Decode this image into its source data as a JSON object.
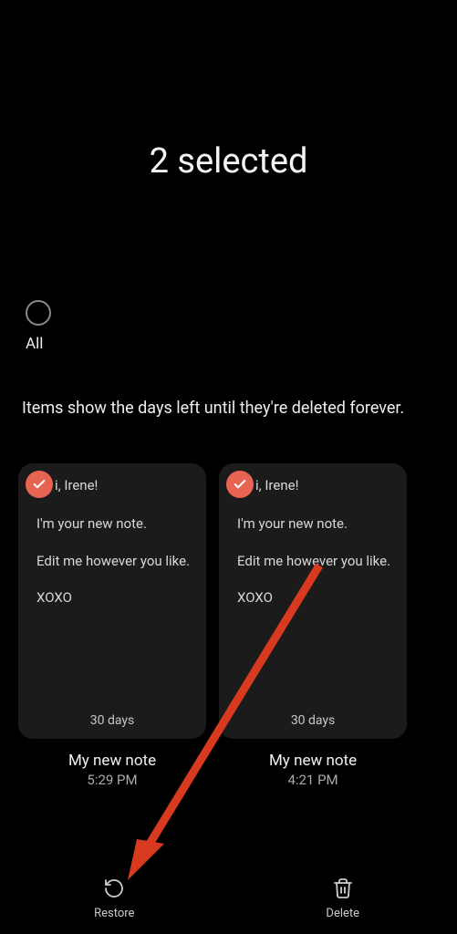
{
  "header": {
    "title": "2 selected"
  },
  "all": {
    "label": "All"
  },
  "info": "Items show the days left until they're deleted forever.",
  "notes": [
    {
      "greeting": "i, Irene!",
      "body": "I'm your new note.\n\nEdit me however you like.\n\nXOXO",
      "days": "30 days",
      "title": "My new note",
      "time": "5:29 PM"
    },
    {
      "greeting": "i, Irene!",
      "body": "I'm your new note.\n\nEdit me however you like.\n\nXOXO",
      "days": "30 days",
      "title": "My new note",
      "time": "4:21 PM"
    }
  ],
  "actions": {
    "restore": "Restore",
    "delete": "Delete"
  }
}
